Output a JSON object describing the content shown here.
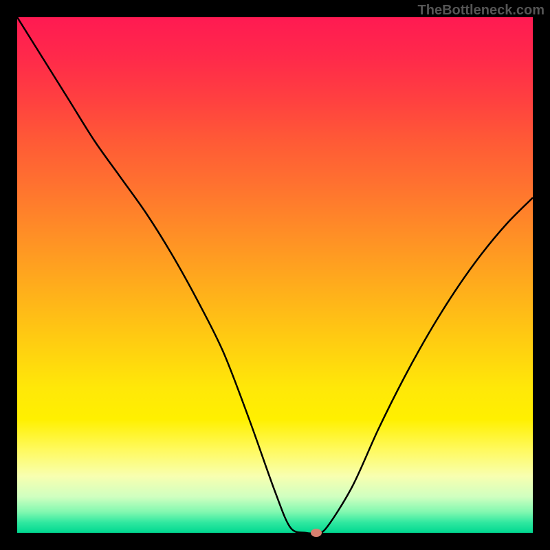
{
  "watermark": "TheBottleneck.com",
  "chart_data": {
    "type": "line",
    "title": "",
    "xlabel": "",
    "ylabel": "",
    "xlim": [
      0,
      100
    ],
    "ylim": [
      0,
      100
    ],
    "series": [
      {
        "name": "bottleneck-curve",
        "x": [
          0,
          5,
          10,
          15,
          20,
          25,
          30,
          35,
          40,
          45,
          50,
          53,
          56,
          58,
          60,
          65,
          70,
          75,
          80,
          85,
          90,
          95,
          100
        ],
        "y": [
          100,
          92,
          84,
          76,
          69,
          62,
          54,
          45,
          35,
          22,
          8,
          1,
          0,
          0,
          1,
          9,
          20,
          30,
          39,
          47,
          54,
          60,
          65
        ]
      }
    ],
    "marker": {
      "x": 58,
      "y": 0
    },
    "gradient_colors": {
      "top": "#ff1a52",
      "mid": "#ffd010",
      "bottom": "#00d890"
    }
  }
}
